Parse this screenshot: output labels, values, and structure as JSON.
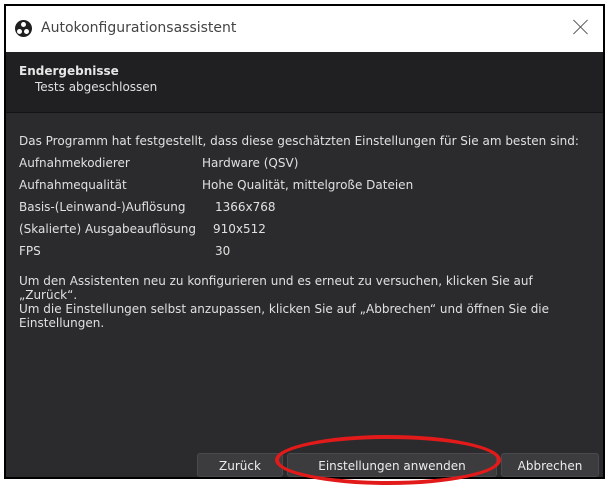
{
  "window": {
    "title": "Autokonfigurationsassistent"
  },
  "header": {
    "title": "Endergebnisse",
    "subtitle": "Tests abgeschlossen"
  },
  "intro": "Das Programm hat festgestellt, dass diese geschätzten Einstellungen für Sie am besten sind:",
  "results": [
    {
      "label": "Aufnahmekodierer",
      "value": "Hardware (QSV)"
    },
    {
      "label": "Aufnahmequalität",
      "value": "Hohe Qualität, mittelgroße Dateien"
    },
    {
      "label": "Basis-(Leinwand-)Auflösung",
      "value": "1366x768"
    },
    {
      "label": "(Skalierte) Ausgabeauflösung",
      "value": "910x512"
    },
    {
      "label": "FPS",
      "value": "30"
    }
  ],
  "footer_lines": [
    "Um den Assistenten neu zu konfigurieren und es erneut zu versuchen, klicken Sie auf „Zurück“.",
    "Um die Einstellungen selbst anzupassen, klicken Sie auf „Abbrechen“ und öffnen Sie die",
    "Einstellungen."
  ],
  "buttons": {
    "back": "Zurück",
    "apply": "Einstellungen anwenden",
    "cancel": "Abbrechen"
  },
  "icons": {
    "app": "obs-logo-icon",
    "close": "close-icon"
  },
  "colors": {
    "window_bg": "#2b2b2e",
    "header_bg": "#202023",
    "text": "#e0e0e0",
    "highlight": "#e21a1a"
  }
}
